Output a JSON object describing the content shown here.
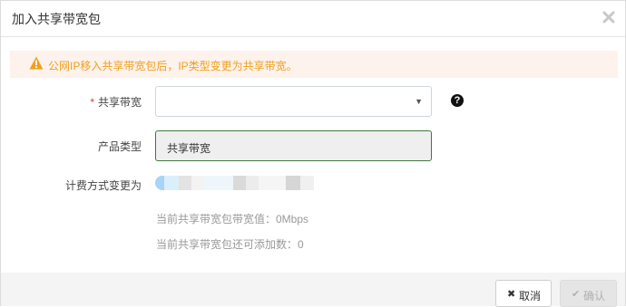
{
  "dialog": {
    "title": "加入共享带宽包"
  },
  "warning": {
    "text": "公网IP移入共享带宽包后，IP类型变更为共享带宽。"
  },
  "form": {
    "shared_bandwidth": {
      "required_mark": "*",
      "label": "共享带宽",
      "value": ""
    },
    "product_type": {
      "label": "产品类型",
      "value": "共享带宽"
    },
    "billing": {
      "label": "计费方式变更为"
    },
    "info": {
      "current_bandwidth": "当前共享带宽包带宽值：0Mbps",
      "addable_count": "当前共享带宽包还可添加数：0"
    }
  },
  "footer": {
    "cancel_icon": "✖",
    "cancel_label": "取消",
    "confirm_icon": "✔",
    "confirm_label": "确认"
  },
  "icons": {
    "close": "close-icon",
    "warning": "warning-triangle-icon",
    "help": "question-circle-icon",
    "dropdown": "caret-down-icon"
  },
  "colors": {
    "warning_text": "#f0a020",
    "warning_bg": "#fdf2ec",
    "required": "#e53935",
    "readonly_border": "#3d7a3d"
  }
}
